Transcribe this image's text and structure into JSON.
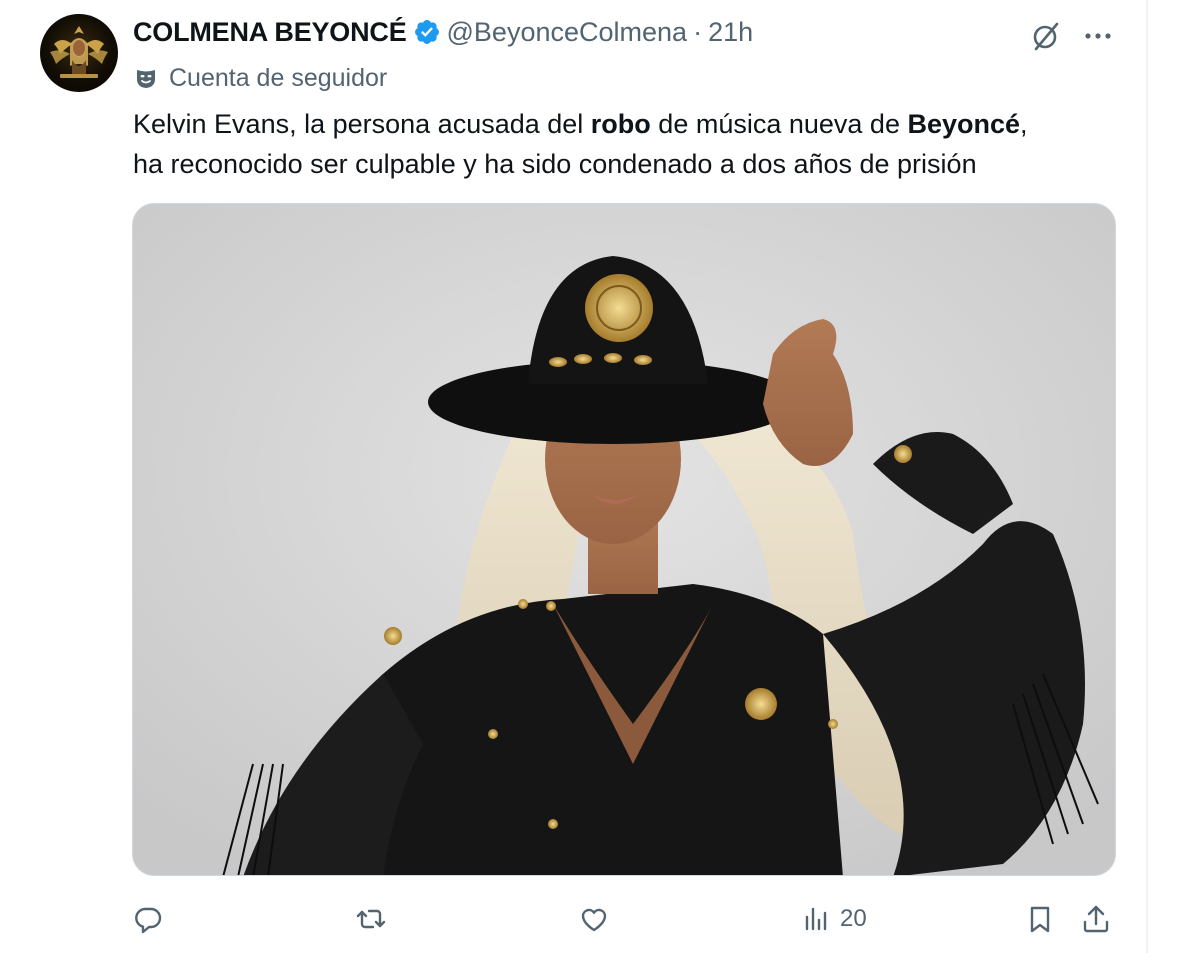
{
  "tweet": {
    "display_name": "COLMENA BEYONCÉ",
    "handle": "@BeyonceColmena",
    "separator": "·",
    "time": "21h",
    "account_label": "Cuenta de seguidor",
    "text_parts": [
      "Kelvin Evans, la persona acusada del ",
      "robo",
      " de música nueva de ",
      "Beyoncé",
      ",",
      "ha reconocido ser culpable y ha sido condenado a dos años de prisión"
    ],
    "views_count": "20"
  },
  "icons": {
    "verified": "verified-badge-icon",
    "grok": "grok-icon",
    "more": "more-icon",
    "label": "theater-mask-icon",
    "reply": "reply-icon",
    "retweet": "retweet-icon",
    "like": "heart-icon",
    "views": "views-bar-chart-icon",
    "bookmark": "bookmark-icon",
    "share": "share-icon"
  },
  "colors": {
    "text": "#0f1419",
    "secondary": "#536471",
    "verified": "#1d9bf0",
    "border": "#cfd9de"
  }
}
